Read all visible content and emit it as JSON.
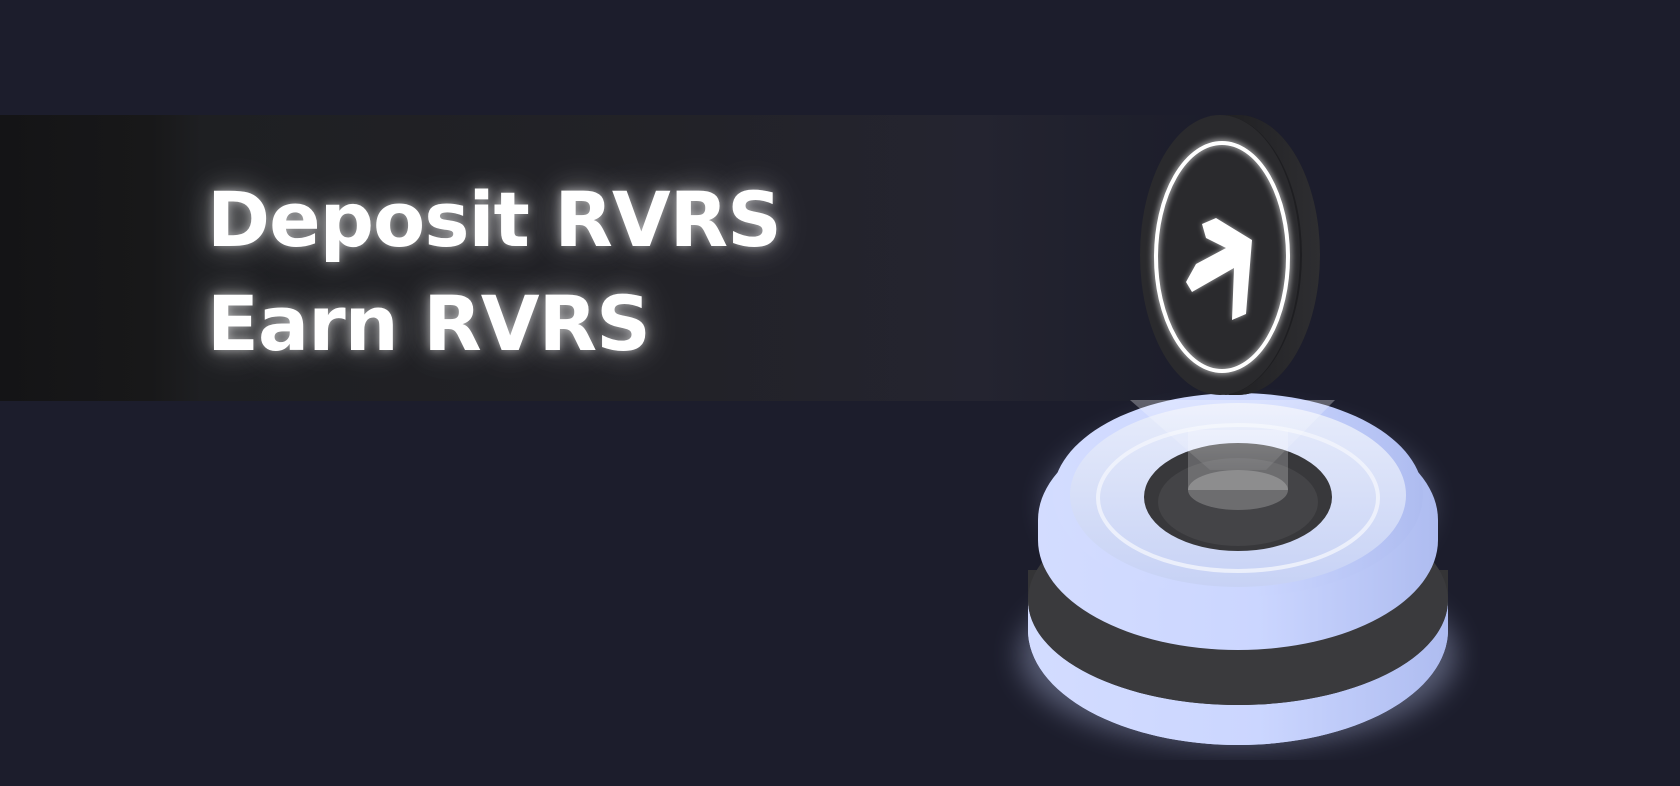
{
  "hero": {
    "headline_line1": "Deposit RVRS",
    "headline_line2": "Earn RVRS"
  },
  "illustration": {
    "coin_icon": "rvrs-arrow-logo-icon",
    "base_icon": "staking-pedestal-icon"
  },
  "colors": {
    "background": "#1c1d2c",
    "band": "#232329",
    "glow": "#c9d6ff",
    "coin_face": "#2b2b2e",
    "text": "#ffffff"
  }
}
